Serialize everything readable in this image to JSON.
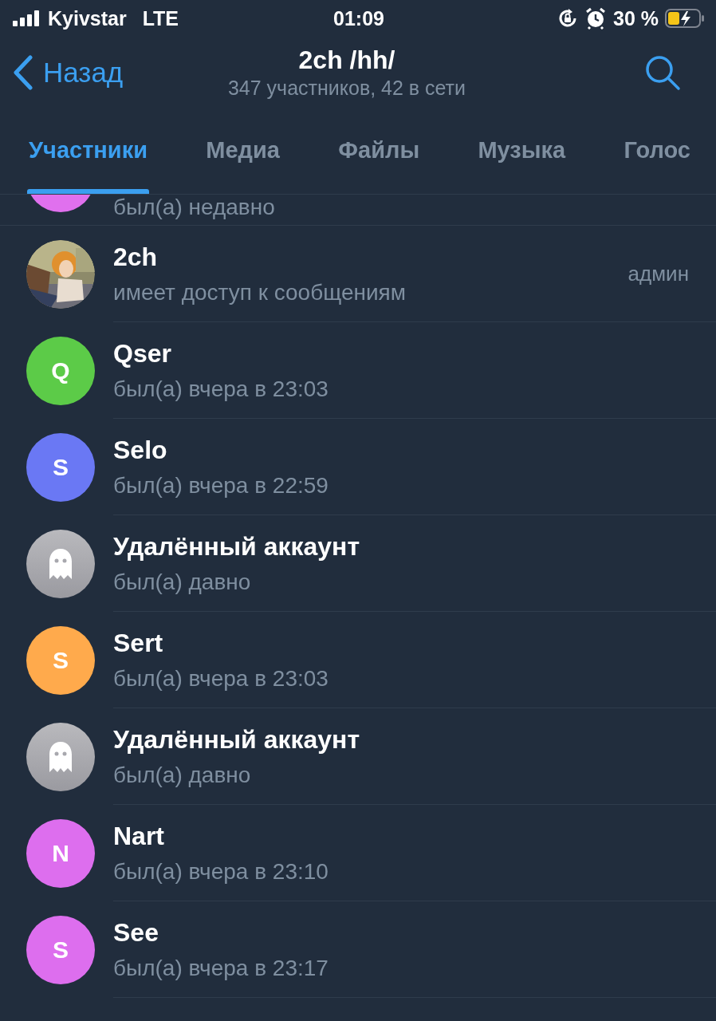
{
  "status_bar": {
    "carrier": "Kyivstar",
    "network": "LTE",
    "time": "01:09",
    "battery": "30 %"
  },
  "nav": {
    "back": "Назад",
    "title": "2ch /hh/",
    "subtitle": "347 участников, 42 в сети"
  },
  "tabs": [
    {
      "label": "Участники",
      "selected": true
    },
    {
      "label": "Медиа",
      "selected": false
    },
    {
      "label": "Файлы",
      "selected": false
    },
    {
      "label": "Музыка",
      "selected": false
    },
    {
      "label": "Голос",
      "selected": false
    }
  ],
  "partial_member": {
    "status": "был(а) недавно",
    "avatar": {
      "kind": "letter",
      "color": "#e070ee"
    }
  },
  "members": [
    {
      "name": "2ch",
      "status": "имеет доступ к сообщениям",
      "role": "админ"
    },
    {
      "name": "Qser",
      "status": "был(а) вчера в 23:03",
      "avatar": {
        "kind": "letter",
        "letter": "Q",
        "color": "#5ccb48"
      }
    },
    {
      "name": "Selo",
      "status": "был(а) вчера в 22:59",
      "avatar": {
        "kind": "letter",
        "letter": "S",
        "color": "#6a78f4"
      }
    },
    {
      "name": "Удалённый аккаунт",
      "status": "был(а) давно",
      "avatar": {
        "kind": "ghost"
      }
    },
    {
      "name": "Sert",
      "status": "был(а) вчера в 23:03",
      "avatar": {
        "kind": "letter",
        "letter": "S",
        "color": "#ffaa4c"
      }
    },
    {
      "name": "Удалённый аккаунт",
      "status": "был(а) давно",
      "avatar": {
        "kind": "ghost"
      }
    },
    {
      "name": "Nart",
      "status": "был(а) вчера в 23:10",
      "avatar": {
        "kind": "letter",
        "letter": "N",
        "color": "#dd6eee"
      }
    },
    {
      "name": "See",
      "status": "был(а) вчера в 23:17",
      "avatar": {
        "kind": "letter",
        "letter": "S",
        "color": "#dd6eee"
      }
    }
  ]
}
